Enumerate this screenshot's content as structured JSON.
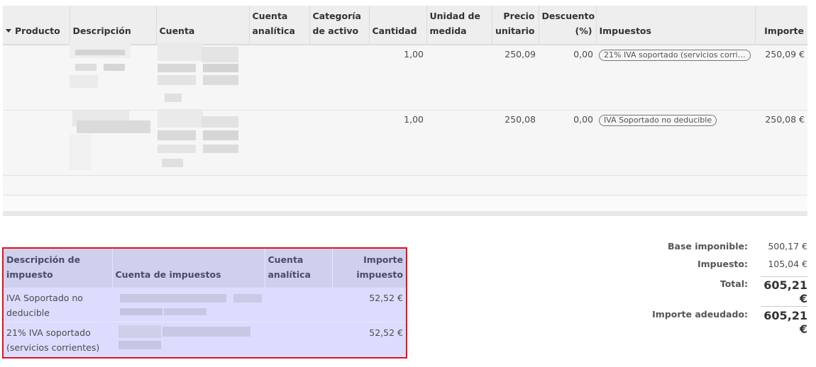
{
  "lines_table": {
    "columns": [
      "Producto",
      "Descripción",
      "Cuenta",
      "Cuenta analítica",
      "Categoría de activo",
      "Cantidad",
      "Unidad de medida",
      "Precio unitario",
      "Descuento (%)",
      "Impuestos",
      "Importe"
    ],
    "rows": [
      {
        "cantidad": "1,00",
        "precio": "250,09",
        "descuento": "0,00",
        "impuestos": "21% IVA soportado (servicios corrientes)",
        "importe": "250,09 €"
      },
      {
        "cantidad": "1,00",
        "precio": "250,08",
        "descuento": "0,00",
        "impuestos": "IVA Soportado no deducible",
        "importe": "250,08 €"
      }
    ]
  },
  "tax_table": {
    "columns": [
      "Descripción de impuesto",
      "Cuenta de impuestos",
      "Cuenta analítica",
      "Importe impuesto"
    ],
    "rows": [
      {
        "descripcion": "IVA Soportado no deducible",
        "importe": "52,52 €"
      },
      {
        "descripcion": "21% IVA soportado (servicios corrientes)",
        "importe": "52,52 €"
      }
    ]
  },
  "totals": {
    "base_label": "Base imponible:",
    "base": "500,17 €",
    "tax_label": "Impuesto:",
    "tax": "105,04 €",
    "total_label": "Total:",
    "total": "605,21 €",
    "due_label": "Importe adeudado:",
    "due": "605,21 €"
  },
  "colors": {
    "highlight_border": "#e0141c",
    "highlight_fill": "#dcdcff"
  }
}
